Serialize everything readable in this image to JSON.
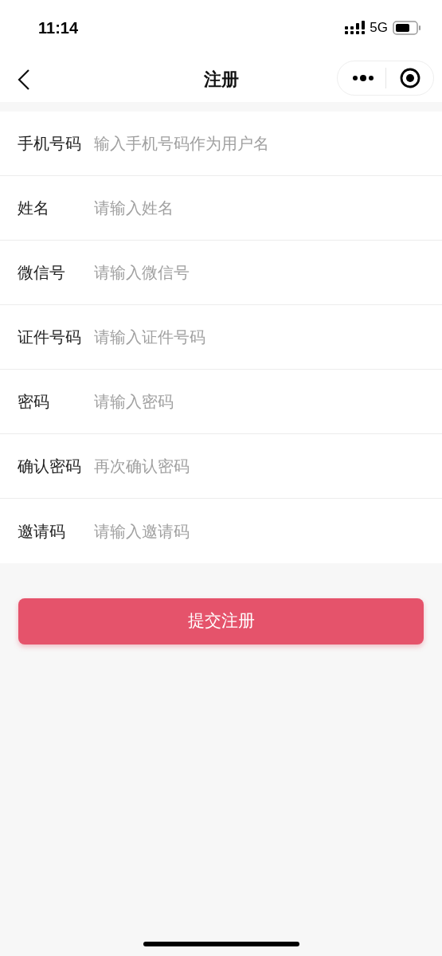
{
  "status_bar": {
    "time": "11:14",
    "network": "5G"
  },
  "nav_bar": {
    "title": "注册"
  },
  "form": {
    "fields": [
      {
        "label": "手机号码",
        "placeholder": "输入手机号码作为用户名"
      },
      {
        "label": "姓名",
        "placeholder": "请输入姓名"
      },
      {
        "label": "微信号",
        "placeholder": "请输入微信号"
      },
      {
        "label": "证件号码",
        "placeholder": "请输入证件号码"
      },
      {
        "label": "密码",
        "placeholder": "请输入密码"
      },
      {
        "label": "确认密码",
        "placeholder": "再次确认密码"
      },
      {
        "label": "邀请码",
        "placeholder": "请输入邀请码"
      }
    ]
  },
  "submit_button": "提交注册"
}
